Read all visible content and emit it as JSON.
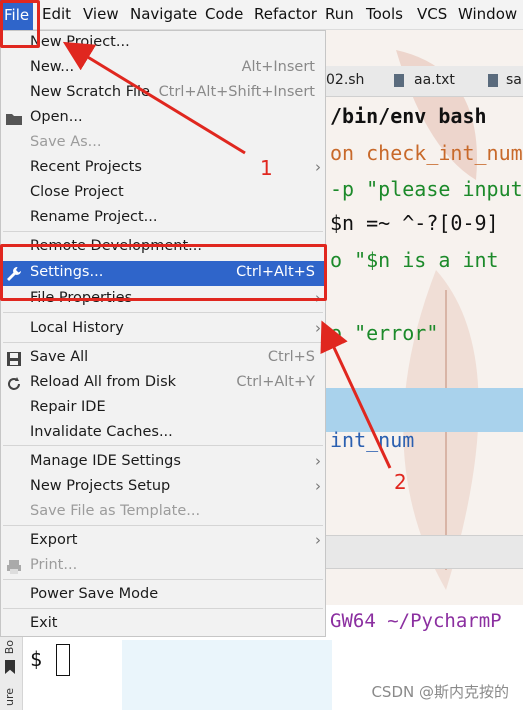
{
  "menubar": {
    "items": [
      "File",
      "Edit",
      "View",
      "Navigate",
      "Code",
      "Refactor",
      "Run",
      "Tools",
      "VCS",
      "Window"
    ]
  },
  "editor": {
    "tabs": [
      "02.sh",
      "aa.txt",
      "sa"
    ],
    "lines": [
      {
        "text": "/bin/env bash",
        "color": "#111111",
        "bold": true
      },
      {
        "text": "on check_int_num",
        "color": "#c8692a"
      },
      {
        "text": "-p \"please input",
        "color": "#1c8a2a"
      },
      {
        "text": "$n =~ ^-?[0-9]",
        "color": "#111111"
      },
      {
        "text": "o \"$n is a int",
        "color": "#1c8a2a"
      },
      {
        "text": "o \"error\"",
        "color": "#1c8a2a"
      },
      {
        "text": "int_num",
        "color": "#2a5fb0"
      }
    ],
    "terminal_path": "GW64 ~/PycharmP",
    "prompt": "$"
  },
  "file_menu": {
    "items": [
      {
        "label": "New Project...",
        "shortcut": "",
        "arrow": false,
        "disabled": false
      },
      {
        "label": "New...",
        "shortcut": "Alt+Insert",
        "arrow": false,
        "disabled": false
      },
      {
        "label": "New Scratch File",
        "shortcut": "Ctrl+Alt+Shift+Insert",
        "arrow": false,
        "disabled": false
      },
      {
        "label": "Open...",
        "shortcut": "",
        "arrow": false,
        "disabled": false,
        "icon": "folder-icon"
      },
      {
        "label": "Save As...",
        "shortcut": "",
        "arrow": false,
        "disabled": true
      },
      {
        "label": "Recent Projects",
        "shortcut": "",
        "arrow": true,
        "disabled": false
      },
      {
        "label": "Close Project",
        "shortcut": "",
        "arrow": false,
        "disabled": false
      },
      {
        "label": "Rename Project...",
        "shortcut": "",
        "arrow": false,
        "disabled": false
      },
      {
        "label": "Remote Development...",
        "shortcut": "",
        "arrow": false,
        "disabled": false
      },
      {
        "label": "Settings...",
        "shortcut": "Ctrl+Alt+S",
        "arrow": false,
        "disabled": false,
        "selected": true,
        "icon": "wrench-icon"
      },
      {
        "label": "File Properties",
        "shortcut": "",
        "arrow": true,
        "disabled": false
      },
      {
        "label": "Local History",
        "shortcut": "",
        "arrow": true,
        "disabled": false
      },
      {
        "label": "Save All",
        "shortcut": "Ctrl+S",
        "arrow": false,
        "disabled": false,
        "icon": "save-icon"
      },
      {
        "label": "Reload All from Disk",
        "shortcut": "Ctrl+Alt+Y",
        "arrow": false,
        "disabled": false,
        "icon": "reload-icon"
      },
      {
        "label": "Repair IDE",
        "shortcut": "",
        "arrow": false,
        "disabled": false
      },
      {
        "label": "Invalidate Caches...",
        "shortcut": "",
        "arrow": false,
        "disabled": false
      },
      {
        "label": "Manage IDE Settings",
        "shortcut": "",
        "arrow": true,
        "disabled": false
      },
      {
        "label": "New Projects Setup",
        "shortcut": "",
        "arrow": true,
        "disabled": false
      },
      {
        "label": "Save File as Template...",
        "shortcut": "",
        "arrow": false,
        "disabled": true
      },
      {
        "label": "Export",
        "shortcut": "",
        "arrow": true,
        "disabled": false
      },
      {
        "label": "Print...",
        "shortcut": "",
        "arrow": false,
        "disabled": true,
        "icon": "print-icon"
      },
      {
        "label": "Power Save Mode",
        "shortcut": "",
        "arrow": false,
        "disabled": false
      },
      {
        "label": "Exit",
        "shortcut": "",
        "arrow": false,
        "disabled": false
      }
    ]
  },
  "annotations": {
    "label_1": "1",
    "label_2": "2",
    "accent_color": "#e0271f"
  },
  "watermark": "CSDN @斯内克按的",
  "side_labels": [
    "Bo",
    "ure"
  ]
}
